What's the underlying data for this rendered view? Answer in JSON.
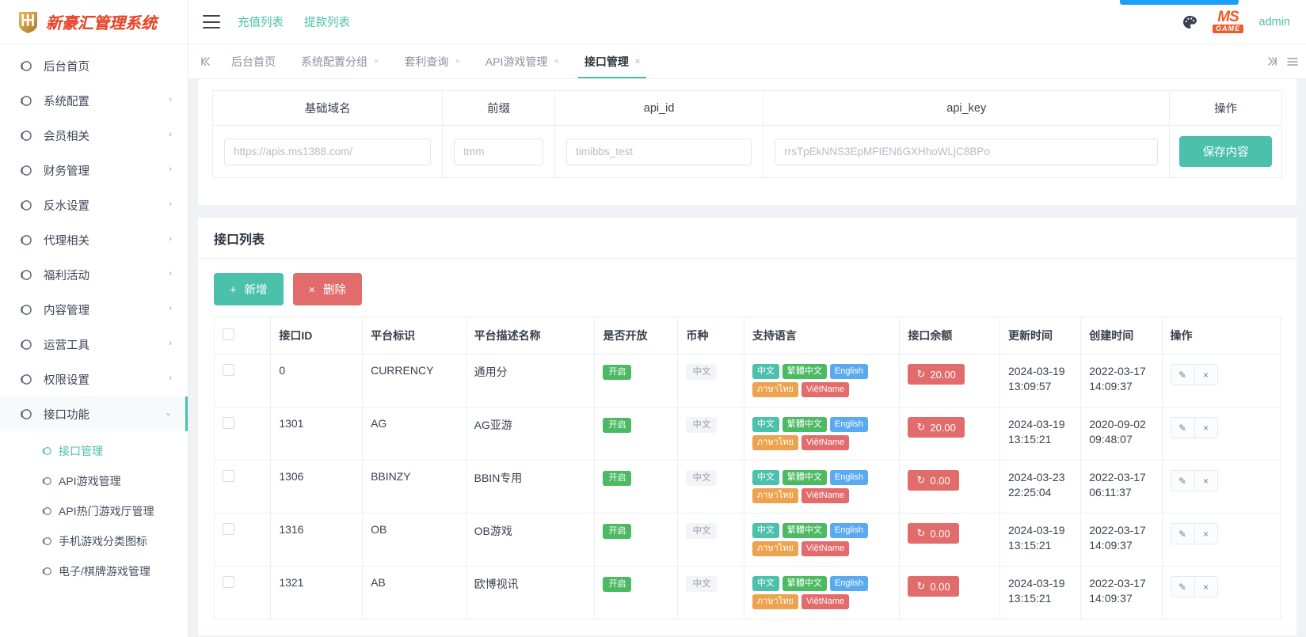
{
  "brand": {
    "logo_text": "新豪汇管理系统",
    "logo_mark": "hh-shield-icon",
    "accent_teal": "#4bc0ab",
    "accent_orange": "#e8452a"
  },
  "header": {
    "menu_toggle": "hamburger-icon",
    "quicklinks": [
      {
        "label": "充值列表"
      },
      {
        "label": "提款列表"
      }
    ],
    "palette_icon": "palette-icon",
    "ms_logo_top": "MS",
    "ms_logo_bottom": "GAME",
    "admin_label": "admin"
  },
  "tabbar": {
    "prev_icon": "skip-backward-icon",
    "next_icon": "skip-forward-icon",
    "menu_icon": "list-menu-icon",
    "tabs": [
      {
        "label": "后台首页",
        "closable": false,
        "active": false
      },
      {
        "label": "系统配置分组",
        "closable": true,
        "active": false
      },
      {
        "label": "套利查询",
        "closable": true,
        "active": false
      },
      {
        "label": "API游戏管理",
        "closable": true,
        "active": false
      },
      {
        "label": "接口管理",
        "closable": true,
        "active": true
      }
    ],
    "close_glyph": "×"
  },
  "sidebar": {
    "items": [
      {
        "label": "后台首页",
        "icon": "circle-icon",
        "arrow": "",
        "active": false
      },
      {
        "label": "系统配置",
        "icon": "circle-icon",
        "arrow": "›",
        "active": false
      },
      {
        "label": "会员相关",
        "icon": "circle-icon",
        "arrow": "›",
        "active": false
      },
      {
        "label": "财务管理",
        "icon": "circle-icon",
        "arrow": "›",
        "active": false
      },
      {
        "label": "反水设置",
        "icon": "circle-icon",
        "arrow": "›",
        "active": false
      },
      {
        "label": "代理相关",
        "icon": "circle-icon",
        "arrow": "›",
        "active": false
      },
      {
        "label": "福利活动",
        "icon": "circle-icon",
        "arrow": "›",
        "active": false
      },
      {
        "label": "内容管理",
        "icon": "circle-icon",
        "arrow": "›",
        "active": false
      },
      {
        "label": "运营工具",
        "icon": "circle-icon",
        "arrow": "›",
        "active": false
      },
      {
        "label": "权限设置",
        "icon": "circle-icon",
        "arrow": "›",
        "active": false
      },
      {
        "label": "接口功能",
        "icon": "circle-icon",
        "arrow": "⌄",
        "active": true
      }
    ],
    "submenu": [
      {
        "label": "接口管理",
        "active": true
      },
      {
        "label": "API游戏管理",
        "active": false
      },
      {
        "label": "API热门游戏厅管理",
        "active": false
      },
      {
        "label": "手机游戏分类图标",
        "active": false
      },
      {
        "label": "电子/棋牌游戏管理",
        "active": false
      }
    ]
  },
  "config_form": {
    "headers": [
      "基础域名",
      "前缀",
      "api_id",
      "api_key",
      "操作"
    ],
    "fields": {
      "base_domain": "https://apis.ms1388.com/",
      "prefix": "tmm",
      "api_id": "timibbs_test",
      "api_key": "rrsTpEkNNS3EpMFIEN6GXHhoWLjC8BPo"
    },
    "save_label": "保存内容"
  },
  "list": {
    "title": "接口列表",
    "add_label": "新增",
    "add_glyph": "+",
    "delete_label": "删除",
    "delete_glyph": "×",
    "columns": [
      "",
      "接口ID",
      "平台标识",
      "平台描述名称",
      "是否开放",
      "币种",
      "支持语言",
      "接口余额",
      "更新时间",
      "创建时间",
      "操作"
    ],
    "edit_glyph": "✎",
    "close_glyph": "×",
    "refresh_glyph": "↻",
    "rows": [
      {
        "id": "0",
        "platform_code": "CURRENCY",
        "platform_name": "通用分",
        "open_status": "开启",
        "currency": "中文",
        "languages": [
          {
            "text": "中文",
            "cls": "l-cn"
          },
          {
            "text": "繁體中文",
            "cls": "l-tw"
          },
          {
            "text": "English",
            "cls": "l-en"
          },
          {
            "text": "ภาษาไทย",
            "cls": "l-th"
          },
          {
            "text": "ViệtName",
            "cls": "l-vn"
          }
        ],
        "balance": "20.00",
        "update_time": "2024-03-19 13:09:57",
        "create_time": "2022-03-17 14:09:37"
      },
      {
        "id": "1301",
        "platform_code": "AG",
        "platform_name": "AG亚游",
        "open_status": "开启",
        "currency": "中文",
        "languages": [
          {
            "text": "中文",
            "cls": "l-cn"
          },
          {
            "text": "繁體中文",
            "cls": "l-tw"
          },
          {
            "text": "English",
            "cls": "l-en"
          },
          {
            "text": "ภาษาไทย",
            "cls": "l-th"
          },
          {
            "text": "ViệtName",
            "cls": "l-vn"
          }
        ],
        "balance": "20.00",
        "update_time": "2024-03-19 13:15:21",
        "create_time": "2020-09-02 09:48:07"
      },
      {
        "id": "1306",
        "platform_code": "BBINZY",
        "platform_name": "BBIN专用",
        "open_status": "开启",
        "currency": "中文",
        "languages": [
          {
            "text": "中文",
            "cls": "l-cn"
          },
          {
            "text": "繁體中文",
            "cls": "l-tw"
          },
          {
            "text": "English",
            "cls": "l-en"
          },
          {
            "text": "ภาษาไทย",
            "cls": "l-th"
          },
          {
            "text": "ViệtName",
            "cls": "l-vn"
          }
        ],
        "balance": "0.00",
        "update_time": "2024-03-23 22:25:04",
        "create_time": "2022-03-17 06:11:37"
      },
      {
        "id": "1316",
        "platform_code": "OB",
        "platform_name": "OB游戏",
        "open_status": "开启",
        "currency": "中文",
        "languages": [
          {
            "text": "中文",
            "cls": "l-cn"
          },
          {
            "text": "繁體中文",
            "cls": "l-tw"
          },
          {
            "text": "English",
            "cls": "l-en"
          },
          {
            "text": "ภาษาไทย",
            "cls": "l-th"
          },
          {
            "text": "ViệtName",
            "cls": "l-vn"
          }
        ],
        "balance": "0.00",
        "update_time": "2024-03-19 13:15:21",
        "create_time": "2022-03-17 14:09:37"
      },
      {
        "id": "1321",
        "platform_code": "AB",
        "platform_name": "欧博视讯",
        "open_status": "开启",
        "currency": "中文",
        "languages": [
          {
            "text": "中文",
            "cls": "l-cn"
          },
          {
            "text": "繁體中文",
            "cls": "l-tw"
          },
          {
            "text": "English",
            "cls": "l-en"
          },
          {
            "text": "ภาษาไทย",
            "cls": "l-th"
          },
          {
            "text": "ViệtName",
            "cls": "l-vn"
          }
        ],
        "balance": "0.00",
        "update_time": "2024-03-19 13:15:21",
        "create_time": "2022-03-17 14:09:37"
      }
    ]
  }
}
